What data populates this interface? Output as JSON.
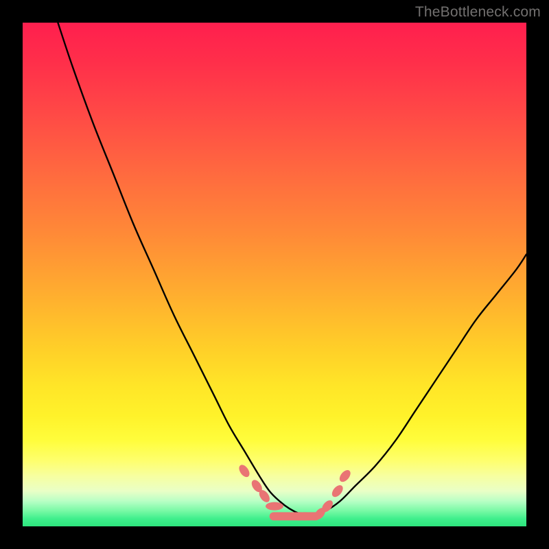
{
  "watermark": "TheBottleneck.com",
  "chart_data": {
    "type": "line",
    "title": "",
    "xlabel": "",
    "ylabel": "",
    "xlim": [
      0,
      100
    ],
    "ylim": [
      0,
      100
    ],
    "series": [
      {
        "name": "left-curve",
        "x": [
          7,
          10,
          14,
          18,
          22,
          26,
          30,
          34,
          38,
          41,
          44,
          47,
          49,
          51,
          53,
          55,
          57
        ],
        "y": [
          100,
          91,
          80,
          70,
          60,
          51,
          42,
          34,
          26,
          20,
          15,
          10,
          7,
          5,
          3.5,
          2.5,
          2
        ]
      },
      {
        "name": "right-curve",
        "x": [
          57,
          60,
          63,
          66,
          70,
          74,
          78,
          82,
          86,
          90,
          94,
          98,
          100
        ],
        "y": [
          2,
          3,
          5,
          8,
          12,
          17,
          23,
          29,
          35,
          41,
          46,
          51,
          54
        ]
      },
      {
        "name": "bottom-beads",
        "x": [
          44,
          46.5,
          48,
          50,
          55,
          56,
          59,
          60.5,
          62.5,
          64
        ],
        "y": [
          11,
          8,
          6,
          4,
          2,
          2,
          2.5,
          4,
          7,
          10
        ]
      }
    ],
    "bead_color": "#e97474",
    "curve_color": "#000000"
  }
}
